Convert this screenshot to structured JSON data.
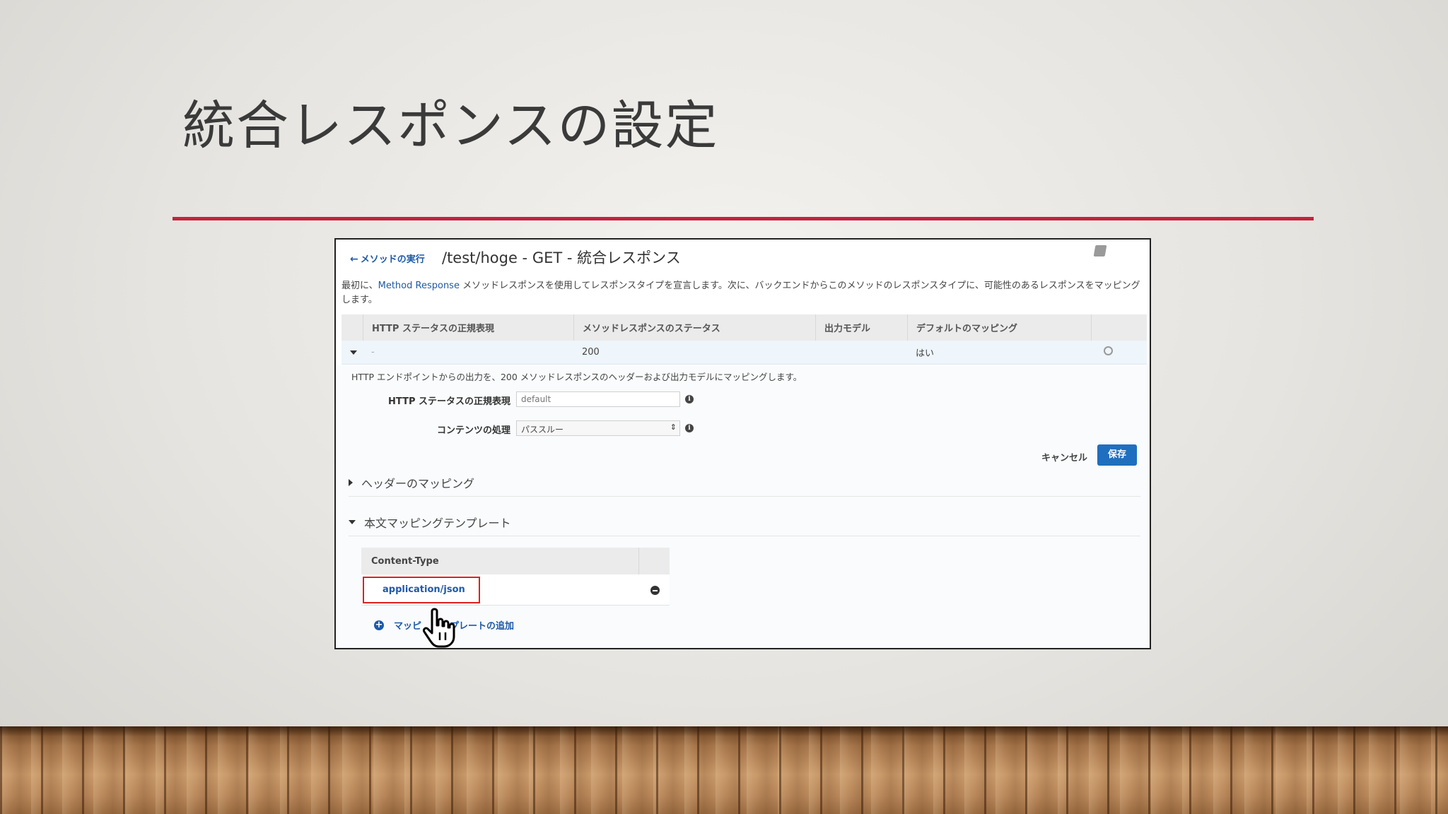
{
  "slide": {
    "title": "統合レスポンスの設定",
    "accent_color": "#c4223f"
  },
  "topbar": {
    "back_label": "メソッドの実行",
    "resource_title": "/test/hoge - GET - 統合レスポンス",
    "book_icon": "book-icon"
  },
  "intro": {
    "prefix": "最初に、",
    "link": "Method Response",
    "text": " メソッドレスポンスを使用してレスポンスタイプを宣言します。次に、バックエンドからこのメソッドのレスポンスタイプに、可能性のあるレスポンスをマッピングします。"
  },
  "response_table": {
    "headers": [
      "HTTP ステータスの正規表現",
      "メソッドレスポンスのステータス",
      "出力モデル",
      "デフォルトのマッピング"
    ],
    "row": {
      "regex": "-",
      "status": "200",
      "model": "",
      "default_mapping": "はい"
    }
  },
  "detail": {
    "description": "HTTP エンドポイントからの出力を、200 メソッドレスポンスのヘッダーおよび出力モデルにマッピングします。",
    "regex_label": "HTTP ステータスの正規表現",
    "regex_placeholder": "default",
    "content_label": "コンテンツの処理",
    "content_value": "パススルー",
    "cancel_label": "キャンセル",
    "save_label": "保存",
    "accent_color": "#1f6fbf"
  },
  "sections": {
    "header_mapping": "ヘッダーのマッピング",
    "body_template": "本文マッピングテンプレート"
  },
  "content_type_table": {
    "header": "Content-Type",
    "rows": [
      "application/json"
    ],
    "highlight_color": "#e02020"
  },
  "add_template": {
    "label_start": "マッピ",
    "label_end": "プレートの追加"
  }
}
